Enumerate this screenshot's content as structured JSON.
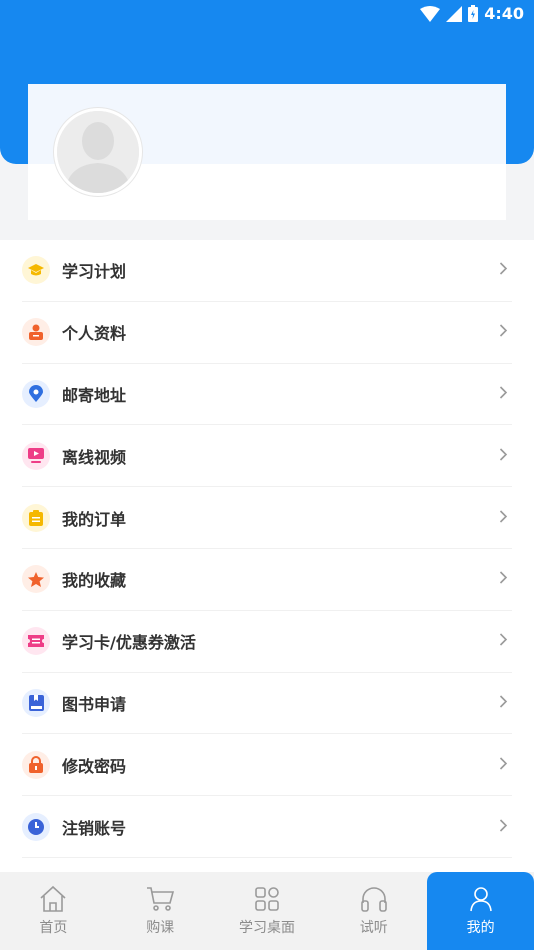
{
  "status_bar": {
    "time": "4:40"
  },
  "menu": {
    "items": [
      {
        "label": "学习计划",
        "icon": "graduation-cap-icon",
        "color": "#f5b800",
        "bg": "#fff6d6"
      },
      {
        "label": "个人资料",
        "icon": "person-card-icon",
        "color": "#f0622c",
        "bg": "#ffeee6"
      },
      {
        "label": "邮寄地址",
        "icon": "location-pin-icon",
        "color": "#2f6fe0",
        "bg": "#e6efff"
      },
      {
        "label": "离线视频",
        "icon": "video-play-icon",
        "color": "#ee3d87",
        "bg": "#ffe6f0"
      },
      {
        "label": "我的订单",
        "icon": "clipboard-icon",
        "color": "#f5b800",
        "bg": "#fff6d6"
      },
      {
        "label": "我的收藏",
        "icon": "star-icon",
        "color": "#f0622c",
        "bg": "#ffeee6"
      },
      {
        "label": "学习卡/优惠券激活",
        "icon": "ticket-icon",
        "color": "#ee3d87",
        "bg": "#ffe6f0"
      },
      {
        "label": "图书申请",
        "icon": "book-icon",
        "color": "#3a63d8",
        "bg": "#e6efff"
      },
      {
        "label": "修改密码",
        "icon": "lock-icon",
        "color": "#f0622c",
        "bg": "#ffeee6"
      },
      {
        "label": "注销账号",
        "icon": "power-icon",
        "color": "#3a63d8",
        "bg": "#e6efff"
      }
    ]
  },
  "tabbar": {
    "tabs": [
      {
        "label": "首页",
        "icon": "home-icon",
        "active": false
      },
      {
        "label": "购课",
        "icon": "cart-icon",
        "active": false
      },
      {
        "label": "学习桌面",
        "icon": "grid-icon",
        "active": false
      },
      {
        "label": "试听",
        "icon": "headphones-icon",
        "active": false
      },
      {
        "label": "我的",
        "icon": "user-icon",
        "active": true
      }
    ]
  },
  "colors": {
    "primary": "#1688f0",
    "text": "#333333",
    "tab_inactive": "#8c8c8c"
  }
}
